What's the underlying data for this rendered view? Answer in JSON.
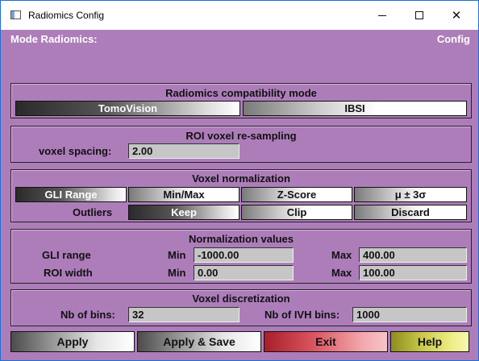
{
  "window": {
    "title": "Radiomics Config"
  },
  "header": {
    "left": "Mode Radiomics:",
    "right": "Config"
  },
  "compat": {
    "title": "Radiomics compatibility mode",
    "options": [
      "TomoVision",
      "IBSI"
    ],
    "selected": "TomoVision"
  },
  "resample": {
    "title": "ROI voxel re-sampling",
    "spacing_label": "voxel spacing:",
    "spacing_value": "2.00"
  },
  "normalization": {
    "title": "Voxel normalization",
    "methods": [
      "GLI Range",
      "Min/Max",
      "Z-Score",
      "μ ± 3σ"
    ],
    "selected_method": "GLI Range",
    "outliers_label": "Outliers",
    "outlier_options": [
      "Keep",
      "Clip",
      "Discard"
    ],
    "selected_outlier": "Keep"
  },
  "norm_values": {
    "title": "Normalization values",
    "gli_label": "GLI range",
    "roi_label": "ROI width",
    "min_label": "Min",
    "max_label": "Max",
    "gli_min": "-1000.00",
    "gli_max": "400.00",
    "roi_min": "0.00",
    "roi_max": "100.00"
  },
  "discretization": {
    "title": "Voxel discretization",
    "bins_label": "Nb of bins:",
    "bins_value": "32",
    "ivh_label": "Nb of IVH bins:",
    "ivh_value": "1000"
  },
  "buttons": {
    "apply": "Apply",
    "apply_save": "Apply & Save",
    "exit": "Exit",
    "help": "Help"
  }
}
